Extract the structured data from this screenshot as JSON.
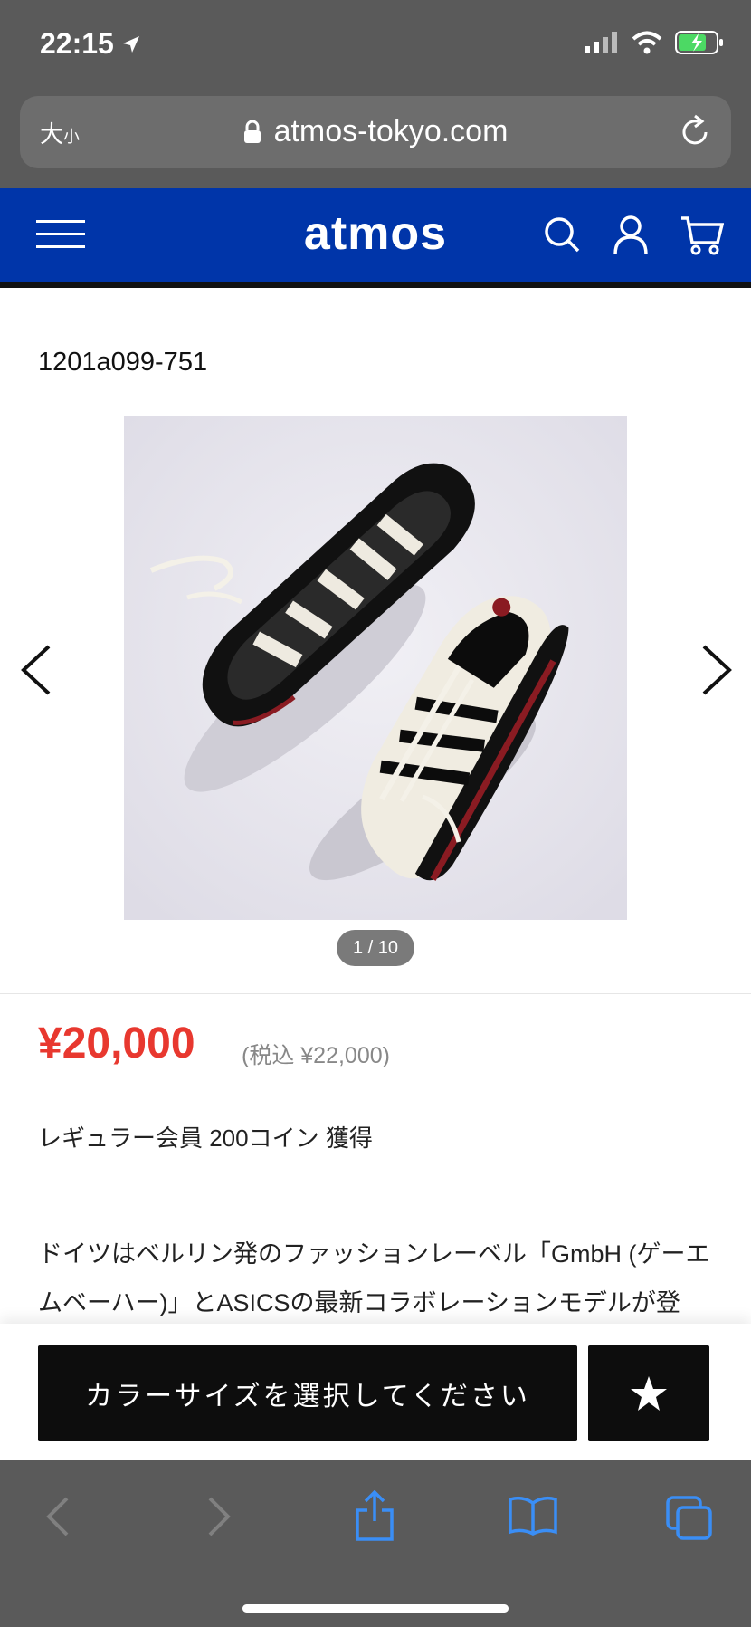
{
  "status": {
    "time": "22:15"
  },
  "browser": {
    "text_size_label": "大",
    "text_size_small": "小",
    "domain": "atmos-tokyo.com"
  },
  "site": {
    "logo": "atmos"
  },
  "product": {
    "sku": "1201a099-751",
    "image_counter": "1 / 10",
    "price": "¥20,000",
    "price_tax": "(税込 ¥22,000)",
    "coin_info": "レギュラー会員 200コイン 獲得",
    "description_line1": "ドイツはベルリン発のファッションレーベル「GmbH (ゲーエ",
    "description_line2": "ムベーハー)」とASICSの最新コラボレーションモデルが登"
  },
  "actions": {
    "select_label": "カラーサイズを選択してください"
  },
  "colors": {
    "header_bg": "#0035a9",
    "price": "#e8382f",
    "safari_gray": "#5a5a5a",
    "ios_blue": "#3a8ef6"
  }
}
